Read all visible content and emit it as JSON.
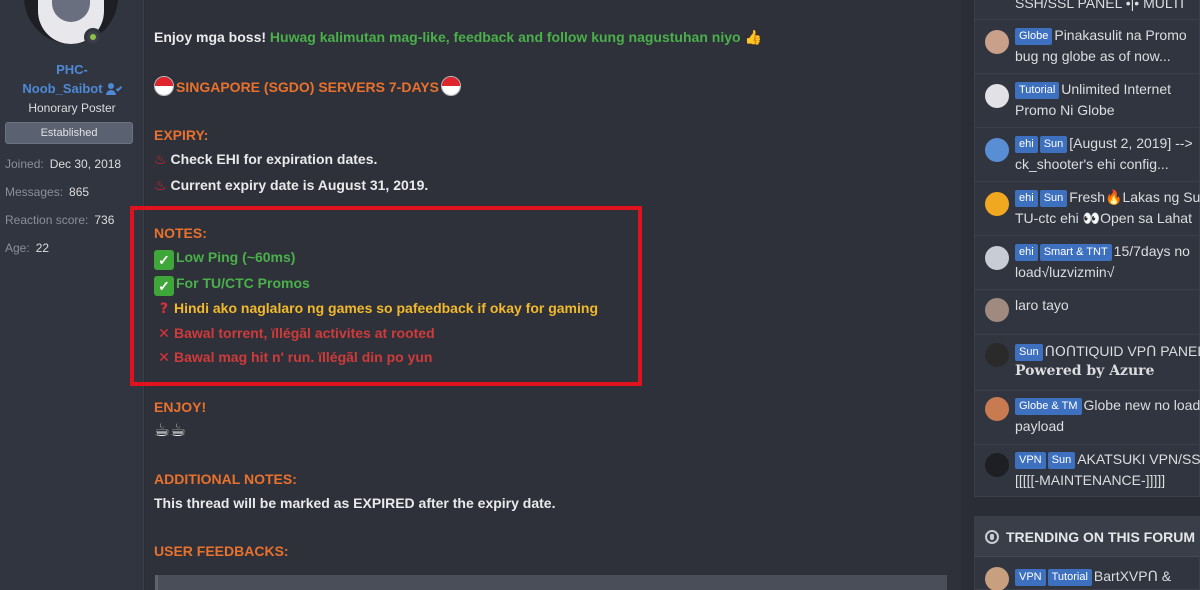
{
  "user": {
    "name_line1": "PHC-",
    "name_line2": "Noob_Saibot",
    "title": "Honorary Poster",
    "banner": "Established",
    "stats": [
      {
        "key": "Joined:",
        "value": "Dec 30, 2018"
      },
      {
        "key": "Messages:",
        "value": "865"
      },
      {
        "key": "Reaction score:",
        "value": "736"
      },
      {
        "key": "Age:",
        "value": "22"
      }
    ]
  },
  "post": {
    "intro_bold": "Enjoy mga boss!",
    "intro_green": "Huwag kalimutan mag-like, feedback and follow kung nagustuhan niyo",
    "heading": "SINGAPORE (SGDO) SERVERS 7-DAYS",
    "expiry_label": "EXPIRY:",
    "expiry_1": "Check EHI for expiration dates.",
    "expiry_2": "Current expiry date is August 31, 2019.",
    "notes_label": "NOTES:",
    "note_1": "Low Ping (~60ms)",
    "note_2": "For TU/CTC Promos",
    "note_3": "Hindi ako naglalaro ng games so pafeedback if okay for gaming",
    "note_4": "Bawal torrent, ïllégãl activites at rooted",
    "note_5": "Bawal mag hit n' run. ïllégãl din po yun",
    "enjoy_label": "ENJOY!",
    "enjoy_emoji": "☕☕",
    "additional_label": "ADDITIONAL NOTES:",
    "additional_text": "This thread will be marked as EXPIRED after the expiry date.",
    "feedback_label": "USER FEEDBACKS:"
  },
  "sidebar": {
    "top_partial": "SSH/SSL PANEL •|• MULTI",
    "items": [
      {
        "badges": [
          "Globe"
        ],
        "line1": "Pinakasulit na Promo",
        "line2": "bug ng globe as of now..."
      },
      {
        "badges": [
          "Tutorial"
        ],
        "line1": "Unlimited Internet",
        "line2": "Promo Ni Globe"
      },
      {
        "badges": [
          "ehi",
          "Sun"
        ],
        "line1": "[August 2, 2019] -->",
        "line2": "ck_shooter's ehi config..."
      },
      {
        "badges": [
          "ehi",
          "Sun"
        ],
        "line1": "Fresh🔥Lakas ng Su",
        "line2": "TU-ctc ehi 👀Open sa Lahat"
      },
      {
        "badges": [
          "ehi",
          "Smart & TNT"
        ],
        "line1": "15/7days no",
        "line2": "load√luzvizmin√"
      },
      {
        "badges": [],
        "line1": "laro tayo",
        "line2": ""
      },
      {
        "badges": [
          "Sun"
        ],
        "line1": "ՈՕՈTIQUID VPՈ PANEL",
        "line2": "Powered by Azure"
      },
      {
        "badges": [
          "Globe & TM"
        ],
        "line1": "Globe new no load",
        "line2": "payload"
      },
      {
        "badges": [
          "VPN",
          "Sun"
        ],
        "line1": "AKATSUKI VPN/SS",
        "line2": "[[[[[-MAINTENANCE-]]]]]"
      }
    ],
    "trending": {
      "title": "TRENDING ON THIS FORUM",
      "first": {
        "badges": [
          "VPN",
          "Tutorial"
        ],
        "line1": "BartXVPՈ &"
      }
    }
  }
}
